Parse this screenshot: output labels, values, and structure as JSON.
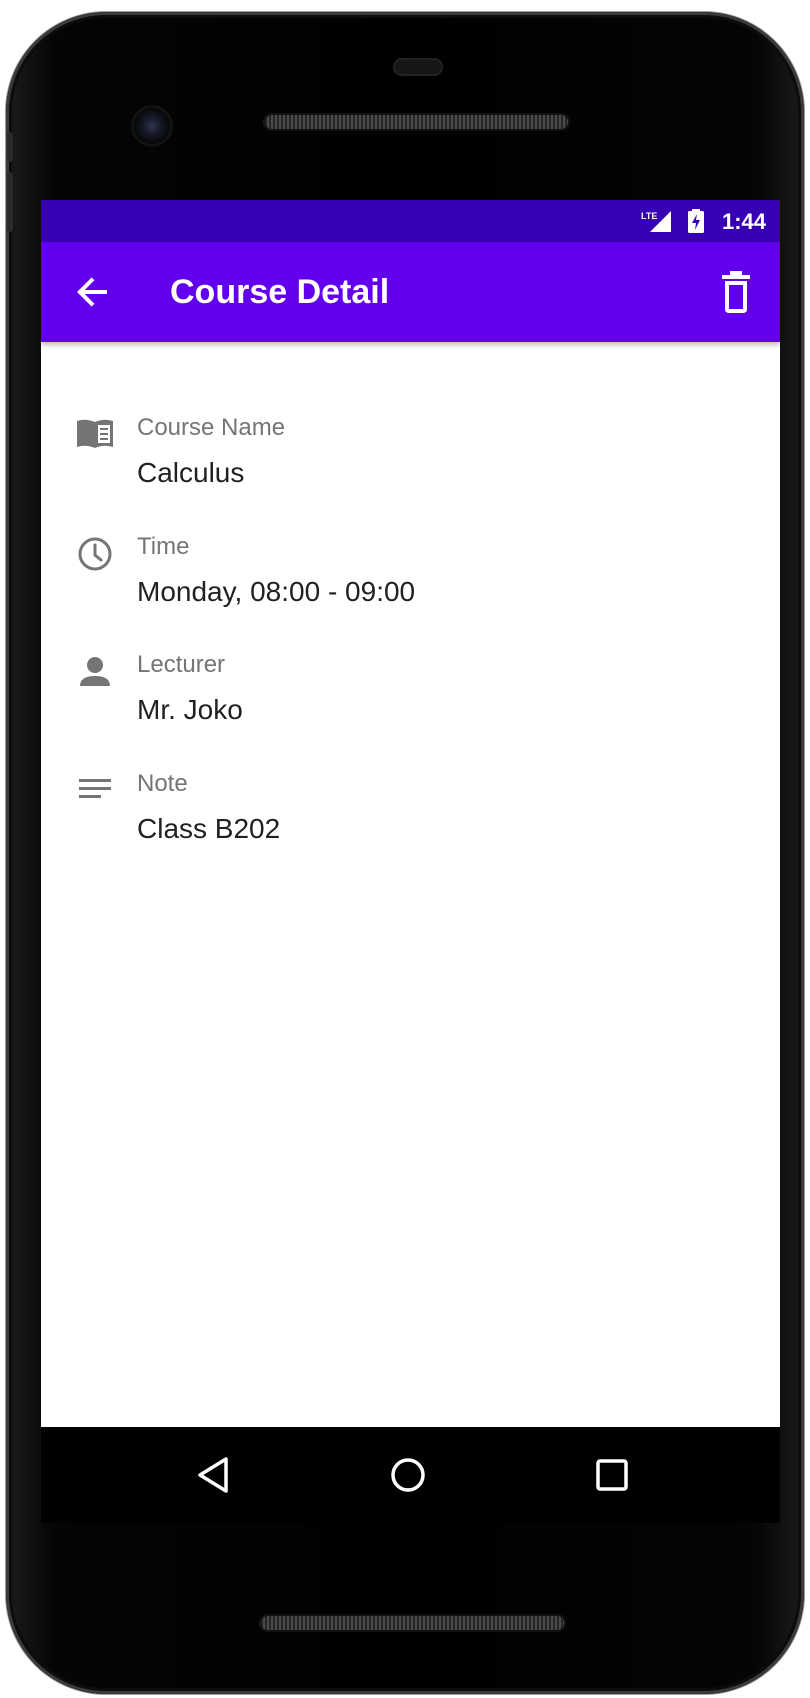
{
  "status_bar": {
    "time": "1:44",
    "network": "LTE",
    "icons": [
      "lte-signal-icon",
      "battery-charging-icon"
    ]
  },
  "app_bar": {
    "title": "Course Detail",
    "back_icon": "arrow-back-icon",
    "delete_icon": "trash-icon"
  },
  "details": [
    {
      "icon": "book-icon",
      "label": "Course Name",
      "value": "Calculus"
    },
    {
      "icon": "clock-icon",
      "label": "Time",
      "value": "Monday, 08:00 - 09:00"
    },
    {
      "icon": "person-icon",
      "label": "Lecturer",
      "value": "Mr. Joko"
    },
    {
      "icon": "notes-icon",
      "label": "Note",
      "value": "Class B202"
    }
  ],
  "nav_bar": {
    "buttons": [
      "back-triangle-icon",
      "home-circle-icon",
      "recents-square-icon"
    ]
  },
  "colors": {
    "status_bar": "#3700b3",
    "app_bar": "#6200ee",
    "icon_gray": "#757575",
    "label_gray": "#757575",
    "value_text": "#212121"
  }
}
